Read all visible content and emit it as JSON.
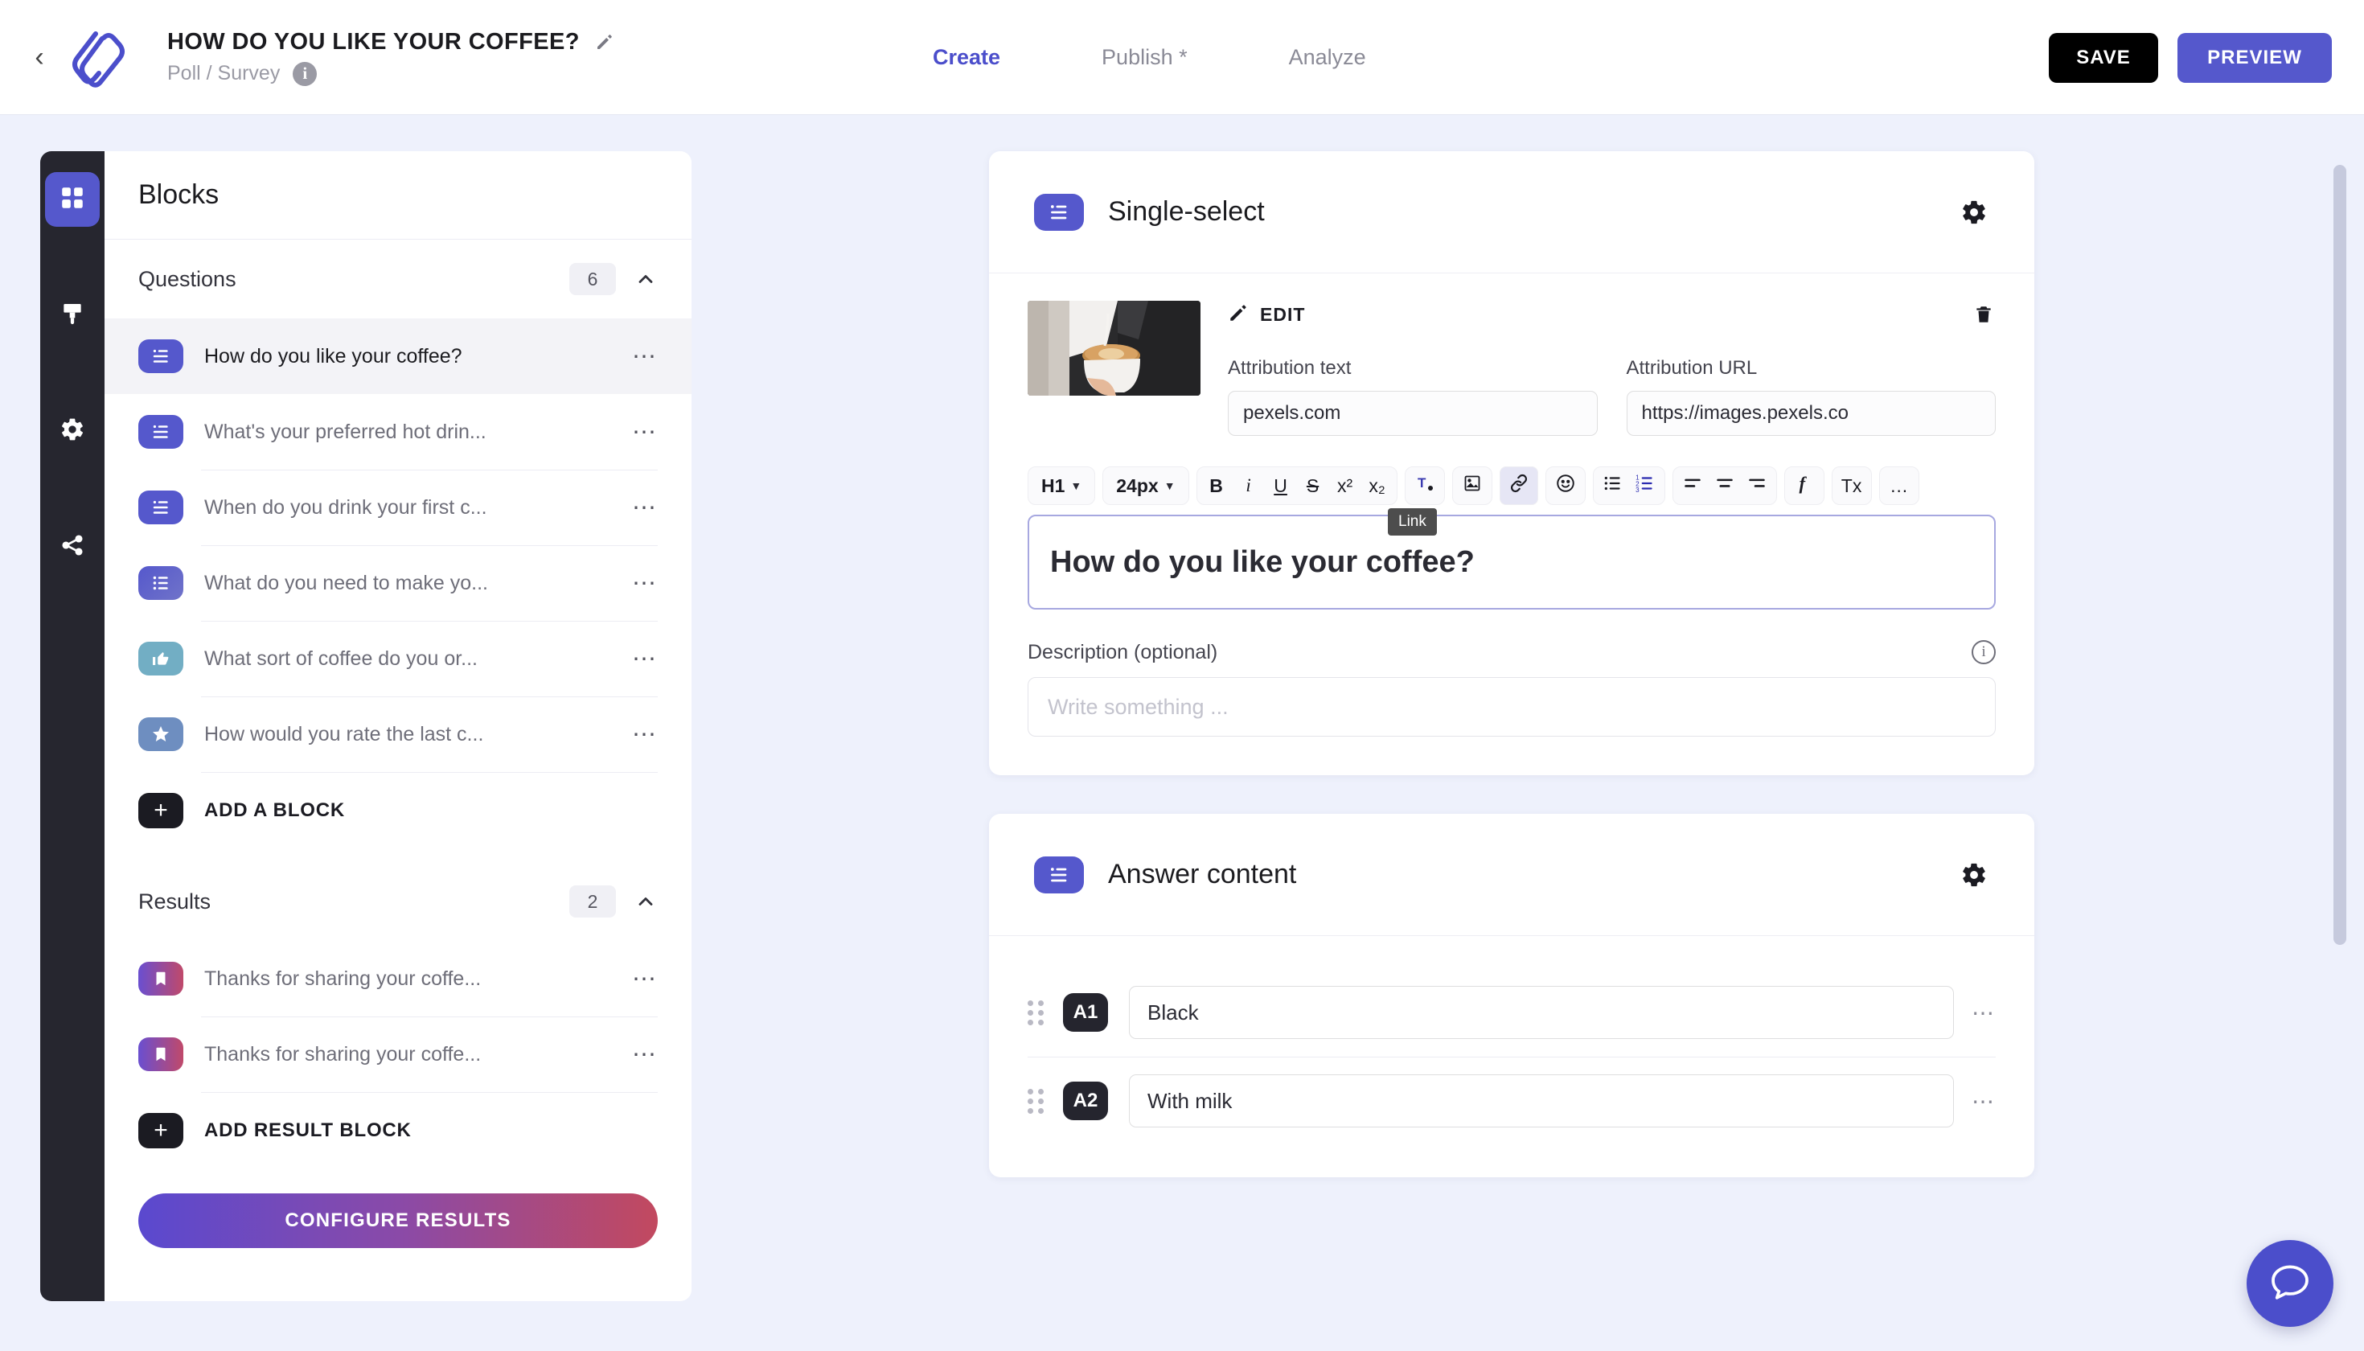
{
  "header": {
    "back_icon": "chevron-left-icon",
    "logo_icon": "app-logo-icon",
    "title": "HOW DO YOU LIKE YOUR COFFEE?",
    "title_edit_icon": "pencil-icon",
    "subtitle": "Poll / Survey",
    "subtitle_info_icon": "info-icon",
    "nav": [
      {
        "label": "Create",
        "active": true
      },
      {
        "label": "Publish *",
        "active": false
      },
      {
        "label": "Analyze",
        "active": false
      }
    ],
    "save_label": "SAVE",
    "preview_label": "PREVIEW",
    "accent_color": "#5558cc",
    "save_color": "#000000"
  },
  "rail": {
    "items": [
      {
        "icon": "blocks-grid-icon",
        "active": true
      },
      {
        "icon": "paint-brush-icon",
        "active": false
      },
      {
        "icon": "gear-icon",
        "active": false
      },
      {
        "icon": "share-branch-icon",
        "active": false
      }
    ]
  },
  "blocks_panel": {
    "title": "Blocks",
    "questions_section": {
      "title": "Questions",
      "count": "6",
      "collapse_icon": "chevron-up-icon",
      "items": [
        {
          "label": "How do you like your coffee?",
          "chip": "single-select-icon",
          "chip_style": "purple",
          "selected": true
        },
        {
          "label": "What's your preferred hot drin...",
          "chip": "single-select-icon",
          "chip_style": "purple",
          "selected": false
        },
        {
          "label": "When do you drink your first c...",
          "chip": "single-select-icon",
          "chip_style": "purple",
          "selected": false
        },
        {
          "label": "What do you need to make yo...",
          "chip": "multi-select-icon",
          "chip_style": "purple2",
          "selected": false
        },
        {
          "label": "What sort of coffee do you or...",
          "chip": "thumbs-up-icon",
          "chip_style": "teal",
          "selected": false
        },
        {
          "label": "How would you rate the last c...",
          "chip": "star-icon",
          "chip_style": "blue",
          "selected": false
        }
      ],
      "add_label": "ADD A BLOCK",
      "add_icon": "plus-icon"
    },
    "results_section": {
      "title": "Results",
      "count": "2",
      "collapse_icon": "chevron-up-icon",
      "items": [
        {
          "label": "Thanks for sharing your coffe...",
          "chip": "bookmark-icon",
          "chip_style": "grad"
        },
        {
          "label": "Thanks for sharing your coffe...",
          "chip": "bookmark-icon",
          "chip_style": "grad"
        }
      ],
      "add_label": "ADD RESULT BLOCK",
      "add_icon": "plus-icon"
    },
    "configure_label": "CONFIGURE RESULTS"
  },
  "question_card": {
    "chip_icon": "single-select-icon",
    "title": "Single-select",
    "settings_icon": "gear-icon",
    "media": {
      "thumb_alt": "barista-pouring-latte-art",
      "edit_label": "EDIT",
      "edit_icon": "pencil-icon",
      "delete_icon": "trash-icon",
      "attribution_text_label": "Attribution text",
      "attribution_text_value": "pexels.com",
      "attribution_url_label": "Attribution URL",
      "attribution_url_value": "https://images.pexels.co"
    },
    "toolbar": {
      "heading_value": "H1",
      "font_size_value": "24px",
      "bold": "B",
      "italic": "i",
      "underline": "U",
      "strike": "S",
      "superscript": "x²",
      "subscript": "x₂",
      "text_color": "T",
      "image": "image-icon",
      "link": "link-icon",
      "emoji": "emoji-icon",
      "bullet_list": "bullet-list-icon",
      "numbered_list": "numbered-list-icon",
      "align_left": "align-left-icon",
      "align_center": "align-center-icon",
      "align_right": "align-right-icon",
      "formula": "formula-icon",
      "clear_format": "Tx",
      "more": "…",
      "tooltip": "Link"
    },
    "question_text": "How do you like your coffee?",
    "description_label": "Description (optional)",
    "description_info_icon": "info-icon",
    "description_placeholder": "Write something ...",
    "description_value": ""
  },
  "answer_card": {
    "chip_icon": "single-select-icon",
    "title": "Answer content",
    "settings_icon": "gear-icon",
    "answers": [
      {
        "badge": "A1",
        "value": "Black",
        "drag_icon": "drag-handle-icon",
        "menu_icon": "ellipsis-icon"
      },
      {
        "badge": "A2",
        "value": "With milk",
        "drag_icon": "drag-handle-icon",
        "menu_icon": "ellipsis-icon"
      }
    ]
  },
  "chat_fab": {
    "icon": "chat-bubble-icon"
  },
  "scrollbar": {
    "icon": "vertical-scrollbar"
  }
}
